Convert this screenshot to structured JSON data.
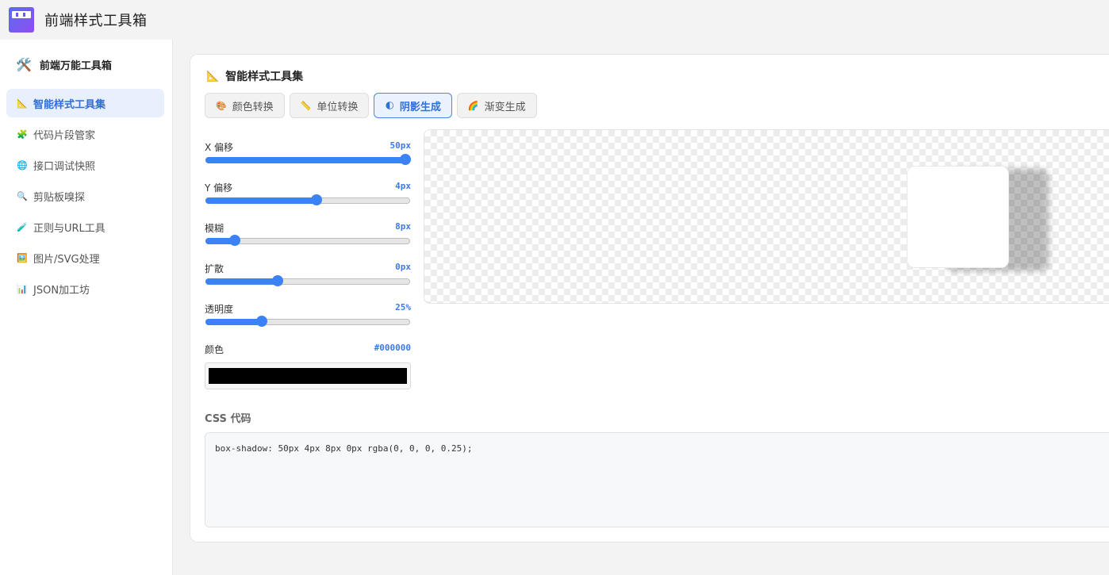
{
  "app": {
    "title": "前端样式工具箱"
  },
  "sidebar": {
    "brand_emoji": "🛠️",
    "brand": "前端万能工具箱",
    "items": [
      {
        "icon": "📐",
        "label": "智能样式工具集"
      },
      {
        "icon": "🧩",
        "label": "代码片段管家"
      },
      {
        "icon": "🌐",
        "label": "接口调试快照"
      },
      {
        "icon": "🔍",
        "label": "剪贴板嗅探"
      },
      {
        "icon": "🧪",
        "label": "正则与URL工具"
      },
      {
        "icon": "🖼️",
        "label": "图片/SVG处理"
      },
      {
        "icon": "📊",
        "label": "JSON加工坊"
      }
    ]
  },
  "card": {
    "title_icon": "📐",
    "title": "智能样式工具集",
    "tabs": [
      {
        "icon": "🎨",
        "label": "颜色转换"
      },
      {
        "icon": "📏",
        "label": "单位转换"
      },
      {
        "icon": "🌓",
        "label": "阴影生成"
      },
      {
        "icon": "🌈",
        "label": "渐变生成"
      }
    ]
  },
  "controls": {
    "x": {
      "label": "X 偏移",
      "value": "50px",
      "level": 1.0
    },
    "y": {
      "label": "Y 偏移",
      "value": "4px",
      "level": 0.54
    },
    "blur": {
      "label": "模糊",
      "value": "8px",
      "level": 0.12
    },
    "spread": {
      "label": "扩散",
      "value": "0px",
      "level": 0.34
    },
    "opacity": {
      "label": "透明度",
      "value": "25%",
      "level": 0.26
    },
    "color": {
      "label": "颜色",
      "value": "#000000"
    }
  },
  "code": {
    "title": "CSS 代码",
    "text": "box-shadow: 50px 4px 8px 0px rgba(0, 0, 0, 0.25);"
  },
  "colors": {
    "accent": "#3b82f6",
    "active_bg": "#e8f0fd"
  }
}
